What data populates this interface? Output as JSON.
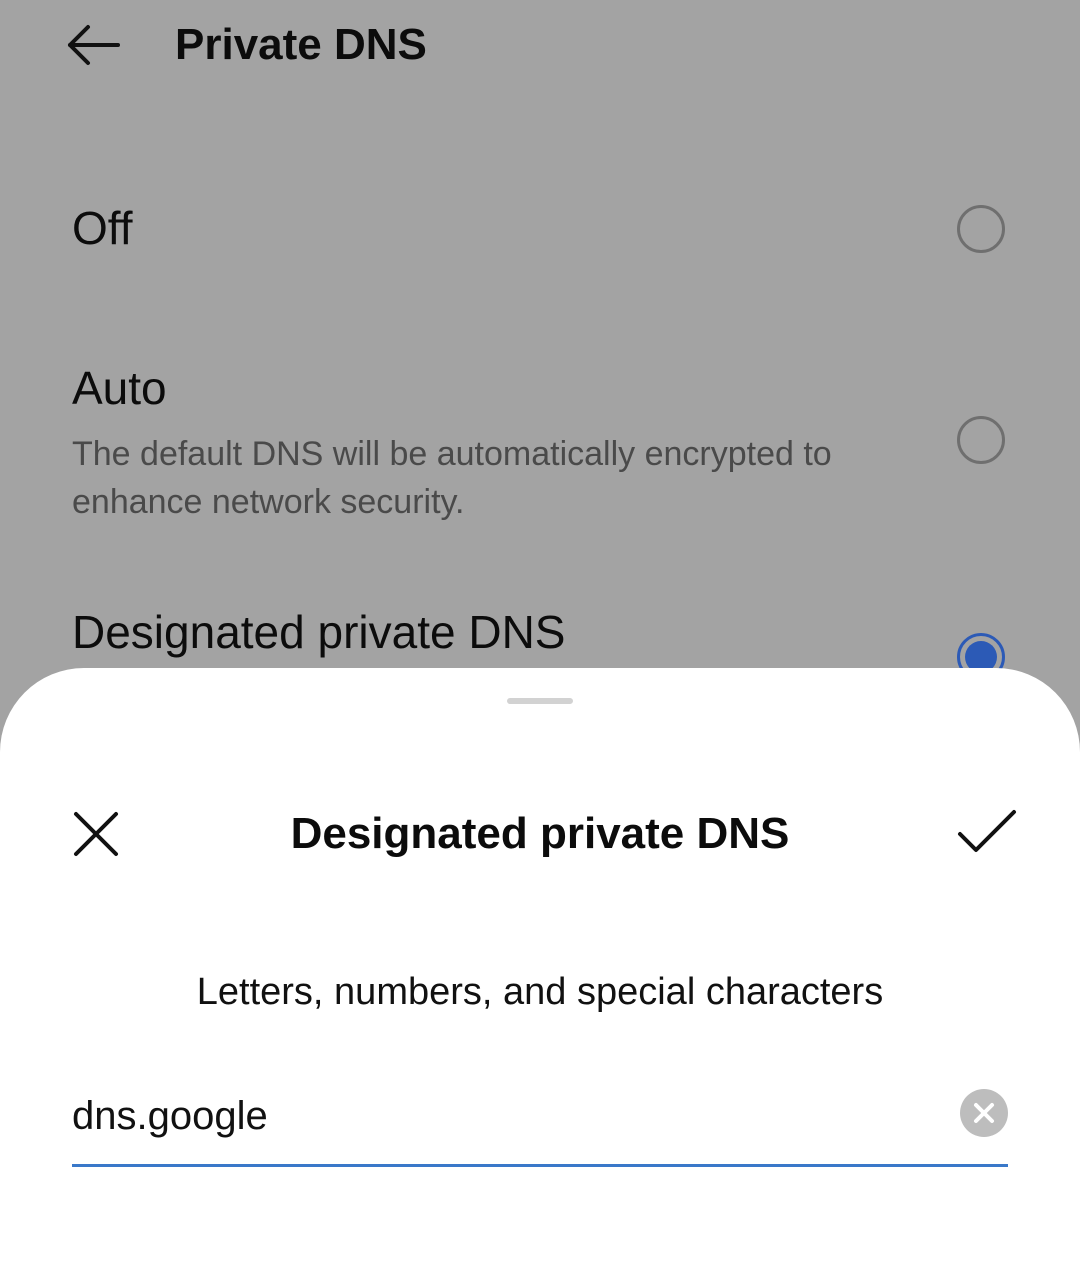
{
  "header": {
    "back_icon": "arrow-left-icon",
    "title": "Private DNS"
  },
  "options": [
    {
      "label": "Off",
      "description": "",
      "selected": false
    },
    {
      "label": "Auto",
      "description": "The default DNS will be automatically encrypted to enhance network security.",
      "selected": false
    },
    {
      "label": "Designated private DNS",
      "description": "",
      "selected": true
    }
  ],
  "sheet": {
    "close_icon": "close-icon",
    "title": "Designated private DNS",
    "confirm_icon": "check-icon",
    "hint": "Letters, numbers, and special characters",
    "input_value": "dns.google",
    "clear_icon": "clear-input-icon"
  },
  "colors": {
    "accent": "#2c5ab6",
    "input_underline": "#3a78c9",
    "scrim_background": "#a3a3a3"
  }
}
